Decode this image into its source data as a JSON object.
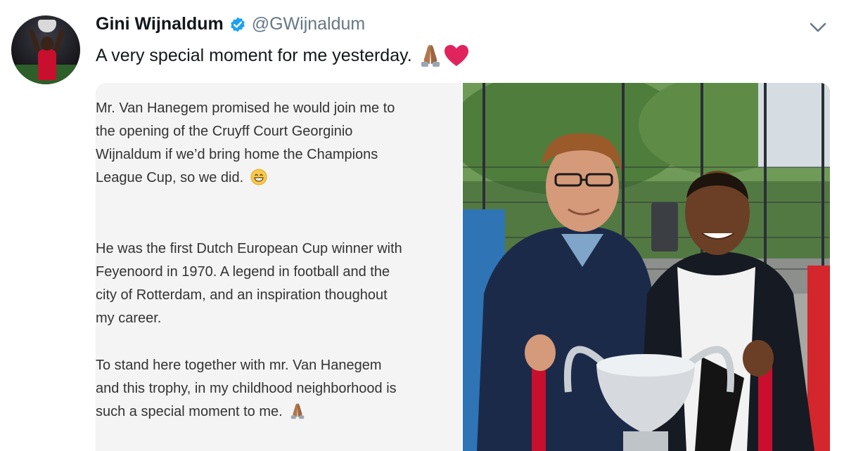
{
  "author": {
    "name": "Gini Wijnaldum",
    "handle": "@GWijnaldum",
    "avatar_icon": "profile-photo-with-trophy",
    "verified_icon": "verified-badge-icon"
  },
  "tweet": {
    "text": "A very special moment for me yesterday.",
    "emojis": [
      "folded-hands-icon",
      "red-heart-icon"
    ]
  },
  "menu": {
    "icon": "chevron-down-icon"
  },
  "statement": {
    "paragraphs": [
      {
        "lines": [
          "Mr. Van Hanegem promised he would join me to",
          "the opening of the Cruyff Court Georginio",
          "Wijnaldum if we’d bring home the Champions",
          "League Cup, so we did."
        ],
        "emoji": "grinning-face-icon"
      },
      {
        "lines": [
          "He was the first Dutch European Cup winner with",
          "Feyenoord in 1970. A legend in football and the",
          "city of Rotterdam, and an inspiration thoughout",
          "my career."
        ]
      },
      {
        "lines": [
          "To stand here together with mr. Van Hanegem",
          "and this trophy, in my childhood neighborhood is",
          "such a special moment to me."
        ],
        "emoji": "folded-hands-icon"
      }
    ]
  },
  "photo": {
    "subject": "two-men-holding-champions-league-trophy"
  },
  "colors": {
    "verified": "#1da1f2",
    "handle": "#657786",
    "heart": "#e0245e",
    "panel": "#f4f4f4"
  }
}
